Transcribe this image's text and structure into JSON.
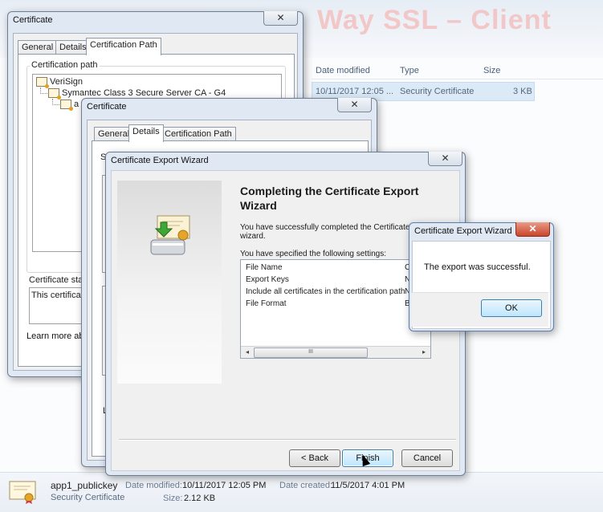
{
  "background": {
    "watermark": "Way SSL – Client",
    "columns": {
      "date_modified": "Date modified",
      "type": "Type",
      "size": "Size"
    },
    "file_row": {
      "date": "10/11/2017 12:05 ...",
      "type": "Security Certificate",
      "size": "3 KB"
    }
  },
  "details_pane": {
    "file_name": "app1_publickey",
    "file_type": "Security Certificate",
    "date_modified_label": "Date modified:",
    "date_modified": "10/11/2017 12:05 PM",
    "date_created_label": "Date created:",
    "date_created": "11/5/2017 4:01 PM",
    "size_label": "Size:",
    "size": "2.12 KB"
  },
  "cert_window_1": {
    "title": "Certificate",
    "close": "✕",
    "tabs": [
      "General",
      "Details",
      "Certification Path"
    ],
    "active_tab": "Certification Path",
    "path_group_label": "Certification path",
    "tree": [
      "VeriSign",
      "Symantec Class 3 Secure Server CA - G4",
      "a"
    ],
    "status_label": "Certificate statu",
    "status_text": "This certificate",
    "learn_more": "Learn more abou"
  },
  "cert_window_2": {
    "title": "Certificate",
    "close": "✕",
    "tabs": [
      "General",
      "Details",
      "Certification Path"
    ],
    "active_tab": "Details",
    "show_label": "Sh",
    "partial_label": "Le"
  },
  "export_wizard": {
    "title": "Certificate Export Wizard",
    "close": "✕",
    "heading": "Completing the Certificate Export Wizard",
    "completed_text_1": "You have successfully completed the Certificate Ex",
    "completed_text_2": "wizard.",
    "settings_intro": "You have specified the following settings:",
    "settings": [
      {
        "name": "File Name",
        "value": "C"
      },
      {
        "name": "Export Keys",
        "value": "N"
      },
      {
        "name": "Include all certificates in the certification path",
        "value": "N"
      },
      {
        "name": "File Format",
        "value": "B"
      }
    ],
    "scroll_left": "◂",
    "scroll_right": "▸",
    "scroll_thumb": "III",
    "back_button": "< Back",
    "finish_button": "Finish",
    "cancel_button": "Cancel"
  },
  "message_box": {
    "title": "Certificate Export Wizard",
    "close": "✕",
    "message": "The export was successful.",
    "ok_button": "OK"
  }
}
